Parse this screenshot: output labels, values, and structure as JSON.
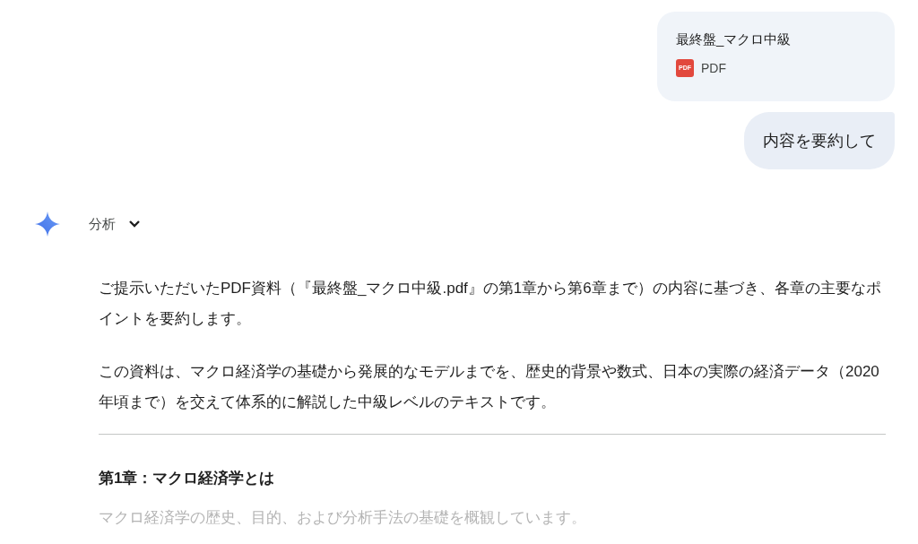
{
  "user_messages": [
    {
      "kind": "file",
      "file_name": "最終盤_マクロ中級",
      "icon_label": "PDF",
      "file_type": "PDF"
    },
    {
      "kind": "text",
      "text": "内容を要約して"
    }
  ],
  "response": {
    "thinking_toggle": {
      "label": "分析",
      "expanded": false
    },
    "paragraphs": [
      "ご提示いただいたPDF資料（『最終盤_マクロ中級.pdf』の第1章から第6章まで）の内容に基づき、各章の主要なポイントを要約します。",
      "この資料は、マクロ経済学の基礎から発展的なモデルまでを、歴史的背景や数式、日本の実際の経済データ（2020年頃まで）を交えて体系的に解説した中級レベルのテキストです。"
    ],
    "sections": [
      {
        "heading": "第1章：マクロ経済学とは",
        "summary": "マクロ経済学の歴史、目的、および分析手法の基礎を概観しています。"
      }
    ]
  }
}
